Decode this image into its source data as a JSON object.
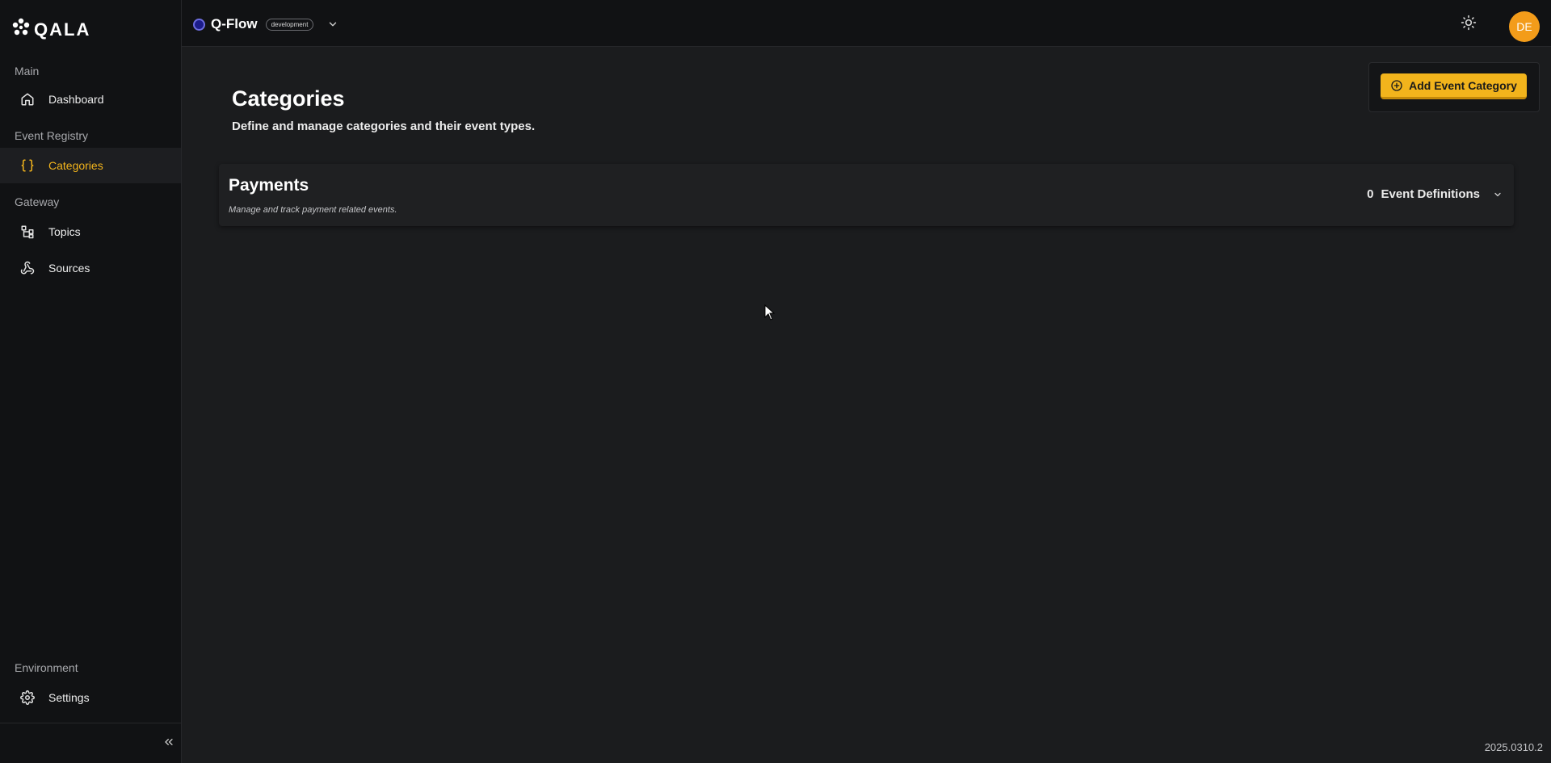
{
  "brand": {
    "logo_text": "QALA"
  },
  "topbar": {
    "app_name": "Q-Flow",
    "environment_badge": "development",
    "avatar_initials": "DE",
    "icons": [
      "chevron-down-icon",
      "sun-icon"
    ]
  },
  "sidebar": {
    "sections": [
      {
        "label": "Main",
        "items": [
          {
            "label": "Dashboard",
            "icon": "home-icon",
            "active": false
          }
        ]
      },
      {
        "label": "Event Registry",
        "items": [
          {
            "label": "Categories",
            "icon": "braces-icon",
            "active": true
          }
        ]
      },
      {
        "label": "Gateway",
        "items": [
          {
            "label": "Topics",
            "icon": "topics-icon",
            "active": false
          },
          {
            "label": "Sources",
            "icon": "webhook-icon",
            "active": false
          }
        ]
      },
      {
        "label": "Environment",
        "items": [
          {
            "label": "Settings",
            "icon": "gear-icon",
            "active": false
          }
        ]
      }
    ]
  },
  "page": {
    "title": "Categories",
    "subtitle": "Define and manage categories and their event types.",
    "add_button_label": "Add Event Category"
  },
  "categories": [
    {
      "name": "Payments",
      "description": "Manage and track payment related events.",
      "event_definition_count": "0",
      "event_definition_label": "Event Definitions"
    }
  ],
  "footer": {
    "version": "2025.0310.2"
  },
  "colors": {
    "accent": "#f2b41c",
    "avatar": "#f39c1a",
    "background": "#1b1c1e",
    "sidebar": "#111214"
  }
}
